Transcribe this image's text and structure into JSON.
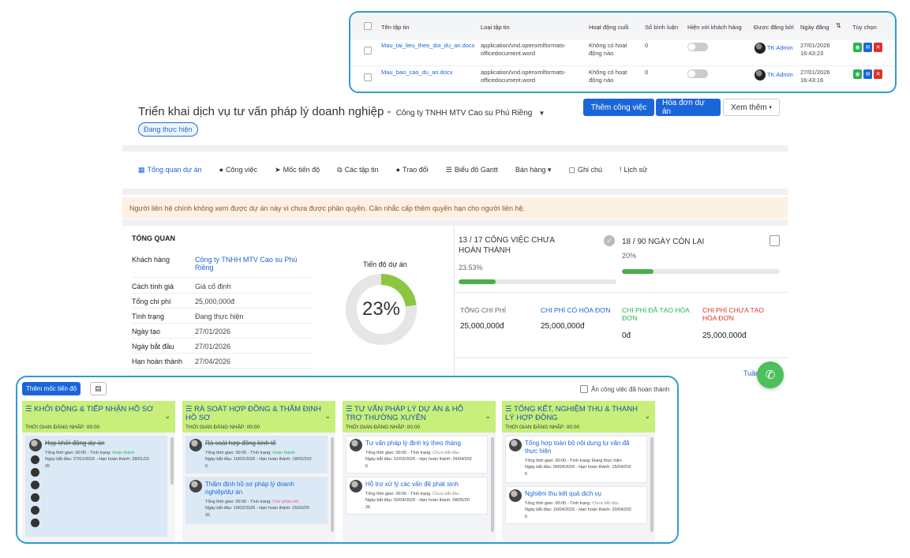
{
  "files_table": {
    "headers": [
      "Tên tập tin",
      "Loại tập tin",
      "Hoạt động cuối",
      "Số bình luận",
      "Hiện với khách hàng",
      "Được đăng bởi",
      "Ngày đăng",
      "Tùy chọn"
    ],
    "rows": [
      {
        "name": "Mau_tai_lieu_theo_doi_du_an.docx",
        "type_line1": "application/vnd.openxmlformats-",
        "type_line2": "officedocument.word",
        "activity_line1": "Không có hoạt",
        "activity_line2": "động nào",
        "comments": "0",
        "posted_by": "TK Admin",
        "date": "27/01/2026",
        "time": "16:43:23"
      },
      {
        "name": "Mau_bao_cao_du_an.docx",
        "type_line1": "application/vnd.openxmlformats-",
        "type_line2": "officedocument.word",
        "activity_line1": "Không có hoạt",
        "activity_line2": "động nào",
        "comments": "0",
        "posted_by": "TK Admin",
        "date": "27/01/2026",
        "time": "16:43:16"
      }
    ],
    "action_icons": [
      "eye-icon",
      "mail-icon",
      "close-icon"
    ]
  },
  "project": {
    "title": "Triển khai dịch vụ tư vấn pháp lý doanh nghiệp -",
    "client": "Công ty TNHH MTV Cao su Phú Riềng",
    "status": "Đang thực hiện",
    "buttons": {
      "add_task": "Thêm công việc",
      "invoice": "Hóa đơn dự án",
      "more": "Xem thêm"
    }
  },
  "tabs": [
    {
      "icon": "grid-icon",
      "glyph": "▦",
      "label": "Tổng quan dự án"
    },
    {
      "icon": "check-circle-icon",
      "glyph": "●",
      "label": "Công việc"
    },
    {
      "icon": "rocket-icon",
      "glyph": "➤",
      "label": "Mốc tiến độ"
    },
    {
      "icon": "files-icon",
      "glyph": "⧉",
      "label": "Các tập tin"
    },
    {
      "icon": "comments-icon",
      "glyph": "●",
      "label": "Trao đổi"
    },
    {
      "icon": "gantt-icon",
      "glyph": "☰",
      "label": "Biểu đồ Gantt"
    },
    {
      "icon": "",
      "glyph": "",
      "label": "Bán hàng ▾"
    },
    {
      "icon": "note-icon",
      "glyph": "▢",
      "label": "Ghi chú"
    },
    {
      "icon": "history-icon",
      "glyph": "!",
      "label": "Lịch sử"
    }
  ],
  "warning": "Người liên hệ chính không xem được dự án này vì chưa được phân quyền. Cân nhắc cấp thêm quyền hạn cho người liên hệ.",
  "overview": {
    "title": "TỔNG QUAN",
    "client_label": "Khách hàng",
    "client_line1": "Công ty TNHH MTV Cao su Phú",
    "client_line2": "Riềng",
    "rows": [
      {
        "k": "Cách tính giá",
        "v": "Giá cố định"
      },
      {
        "k": "Tổng chi phí",
        "v": "25,000,000đ"
      },
      {
        "k": "Tình trạng",
        "v": "Đang thực hiện"
      },
      {
        "k": "Ngày tạo",
        "v": "27/01/2026"
      },
      {
        "k": "Ngày bắt đầu",
        "v": "27/01/2026"
      },
      {
        "k": "Hạn hoàn thành",
        "v": "27/04/2026"
      }
    ],
    "progress_label": "Tiến độ dự án",
    "progress_text": "23%",
    "progress_value": 0.23
  },
  "stats": {
    "tasks_title_line1": "13 / 17 CÔNG VIỆC CHƯA",
    "tasks_title_line2": "HOÀN THÀNH",
    "tasks_pct": "23.53%",
    "tasks_fill": 0.2353,
    "days_title": "18 / 90 NGÀY CÒN LẠI",
    "days_pct": "20%",
    "days_fill": 0.2
  },
  "costs": [
    {
      "line1": "TỔNG CHI PHÍ",
      "line2": "",
      "value": "25,000,000đ",
      "color": "#666666"
    },
    {
      "line1": "CHI PHÍ CÓ HÓA ĐƠN",
      "line2": "",
      "value": "25,000,000đ",
      "color": "#1a66d9"
    },
    {
      "line1": "CHI PHÍ ĐÃ TẠO HÓA",
      "line2": "ĐƠN",
      "value": "0đ",
      "color": "#29b34b"
    },
    {
      "line1": "CHI PHÍ CHƯA TẠO",
      "line2": "HÓA ĐƠN",
      "value": "25,000,000đ",
      "color": "#e0302c"
    }
  ],
  "tuan": "Tuần",
  "milestones": {
    "add_label": "Thêm mốc tiến độ",
    "hide_label": "Ẩn công việc đã hoàn thành",
    "time_label": "THỜI GIAN ĐĂNG NHẬP: 00:00",
    "columns": [
      {
        "title": "KHỞI ĐỘNG & TIẾP NHẬN HỒ SƠ",
        "tasks": [
          {
            "title": "Họp khởi động dự án",
            "strike": true,
            "status": "Hoàn thành",
            "status_class": "green",
            "meta1": "Tổng thời gian: 00:00 - Tình trạng:",
            "meta2": "Ngày bắt đầu: 27/01/2026 - Hạn hoàn thành: 28/01/20",
            "meta3": "26"
          }
        ]
      },
      {
        "title": "RÀ SOÁT HỢP ĐỒNG & THẨM ĐỊNH HỒ SƠ",
        "tasks": [
          {
            "title": "Rà soát hợp đồng kinh tế",
            "strike": true,
            "status": "Hoàn thành",
            "status_class": "green",
            "meta1": "Tổng thời gian: 00:00 - Tình trạng:",
            "meta2": "Ngày bắt đầu: 10/02/2026 - Hạn hoàn thành: 18/02/202",
            "meta3": "6"
          },
          {
            "title": "Thẩm định hồ sơ pháp lý doanh nghiệp/dự án",
            "title2": "p/dự án",
            "strike": false,
            "status": "Chờ phản hồi",
            "status_class": "pink",
            "meta1": "Tổng thời gian: 00:00 - Tình trạng:",
            "meta2": "Ngày bắt đầu: 19/02/2026 - Hạn hoàn thành: 25/02/20",
            "meta3": "26"
          }
        ]
      },
      {
        "title": "TƯ VẤN PHÁP LÝ DỰ ÁN & HỖ TRỢ THƯỜNG XUYÊN",
        "tasks": [
          {
            "title": "Tư vấn pháp lý định kỳ theo tháng",
            "strike": false,
            "status": "Chưa bắt đầu",
            "status_class": "grey",
            "meta1": "Tổng thời gian: 00:00 - Tình trạng:",
            "meta2": "Ngày bắt đầu: 31/03/2026 - Hạn hoàn thành: 26/04/202",
            "meta3": "6"
          },
          {
            "title": "Hỗ trợ xử lý các vấn đề phát sinh",
            "strike": false,
            "status": "Chưa bắt đầu",
            "status_class": "grey",
            "meta1": "Tổng thời gian: 00:00 - Tình trạng:",
            "meta2": "Ngày bắt đầu: 02/04/2026 - Hạn hoàn thành: 08/05/20",
            "meta3": "26"
          }
        ]
      },
      {
        "title": "TỔNG KẾT, NGHIỆM THU & THANH LÝ HỢP ĐỒNG",
        "tasks": [
          {
            "title": "Tổng hợp toàn bộ nội dung tư vấn đã thực hiện",
            "strike": false,
            "status": "Đang thực hiện",
            "status_class": "",
            "meta1": "Tổng thời gian: 00:00 - Tình trạng:",
            "meta2": "Ngày bắt đầu: 06/04/2026 - Hạn hoàn thành: 15/04/202",
            "meta3": "6"
          },
          {
            "title": "Nghiệm thu kết quả dịch vụ",
            "strike": false,
            "status": "Chưa bắt đầu",
            "status_class": "grey",
            "meta1": "Tổng thời gian: 00:00 - Tình trạng:",
            "meta2": "Ngày bắt đầu: 16/04/2026 - Hạn hoàn thành: 20/04/202",
            "meta3": "6"
          }
        ]
      }
    ]
  }
}
